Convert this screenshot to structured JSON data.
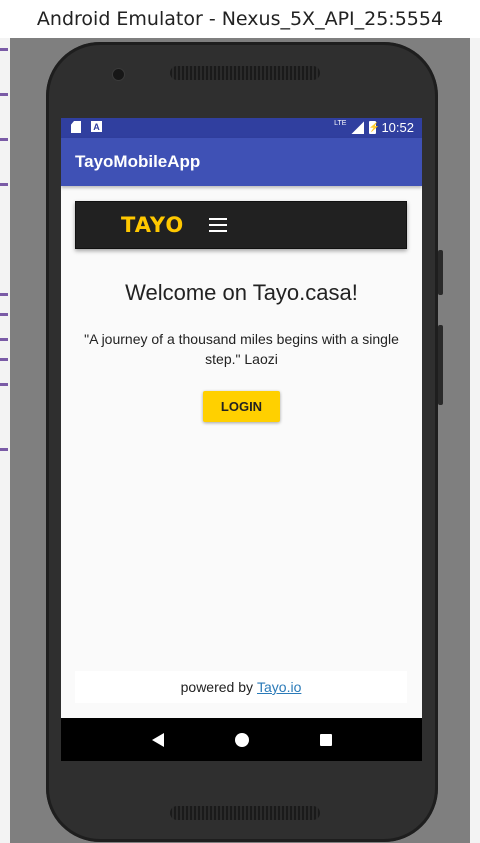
{
  "window": {
    "title": "Android Emulator - Nexus_5X_API_25:5554"
  },
  "statusbar": {
    "time": "10:52",
    "network_label": "LTE"
  },
  "appbar": {
    "title": "TayoMobileApp"
  },
  "navbar": {
    "logo_text": "TAYO"
  },
  "main": {
    "heading": "Welcome on Tayo.casa!",
    "quote": "\"A journey of a thousand miles begins with a single step.\" Laozi",
    "login_label": "LOGIN"
  },
  "footer": {
    "prefix": "powered by",
    "link_text": "Tayo.io"
  },
  "colors": {
    "status_bar": "#303f9f",
    "app_bar": "#3f51b5",
    "brand_yellow": "#ffc800",
    "button_yellow": "#ffd000",
    "navbar_dark": "#212121"
  }
}
